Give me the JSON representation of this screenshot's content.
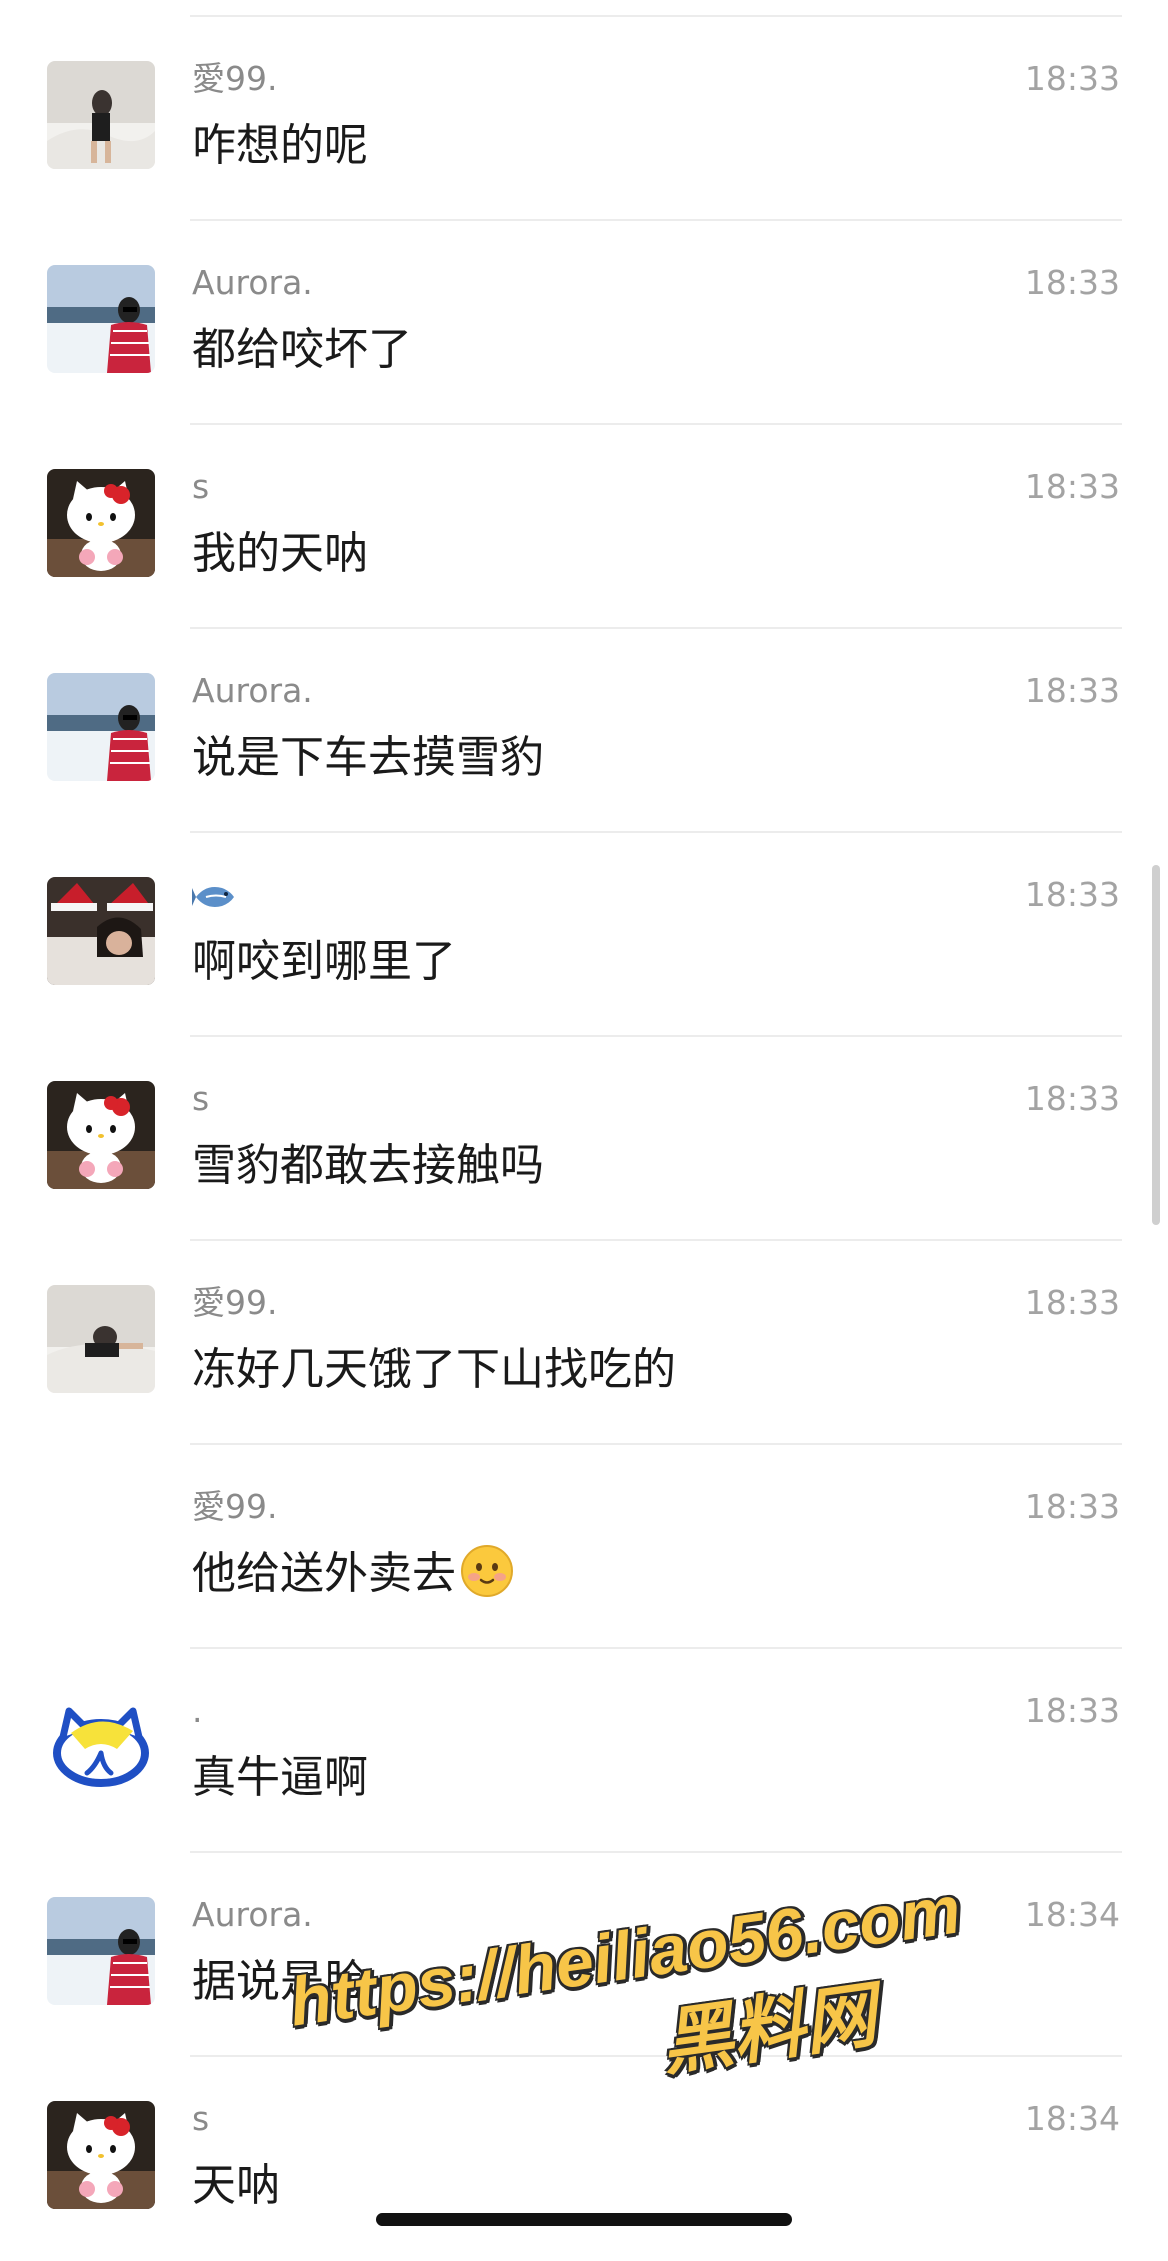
{
  "messages": [
    {
      "sender": "愛99.",
      "time": "18:33",
      "text": "咋想的呢",
      "avatar": "photo-woman-bed"
    },
    {
      "sender": "Aurora.",
      "time": "18:33",
      "text": "都给咬坏了",
      "avatar": "photo-woman-snow"
    },
    {
      "sender": "s",
      "time": "18:33",
      "text": "我的天呐",
      "avatar": "hello-kitty"
    },
    {
      "sender": "Aurora.",
      "time": "18:33",
      "text": "说是下车去摸雪豹",
      "avatar": "photo-woman-snow"
    },
    {
      "sender": "",
      "sender_icon": "fish-icon",
      "time": "18:33",
      "text": "啊咬到哪里了",
      "avatar": "photo-santa-hat"
    },
    {
      "sender": "s",
      "time": "18:33",
      "text": "雪豹都敢去接触吗",
      "avatar": "hello-kitty"
    },
    {
      "sender": "愛99.",
      "time": "18:33",
      "text": "冻好几天饿了下山找吃的",
      "avatar": "photo-woman-bed"
    },
    {
      "sender": "愛99.",
      "time": "18:33",
      "text": "他给送外卖去",
      "text_emoji": "smiling-face-icon",
      "avatar": ""
    },
    {
      "sender": ".",
      "time": "18:33",
      "text": "真牛逼啊",
      "avatar": "cartoon-cat"
    },
    {
      "sender": "Aurora.",
      "time": "18:34",
      "text": "据说是脸",
      "avatar": "photo-woman-snow"
    },
    {
      "sender": "s",
      "time": "18:34",
      "text": "天呐",
      "avatar": "hello-kitty"
    }
  ],
  "watermark": {
    "url": "https://heiliao56.com",
    "name": "黑料网",
    "fill_color": "#f7c548",
    "outline_color": "#2a2a2a"
  },
  "colors": {
    "background": "#ffffff",
    "sender": "#8a8a8a",
    "time": "#a3a3a3",
    "text": "#1a1a1a",
    "divider": "#ececec"
  }
}
